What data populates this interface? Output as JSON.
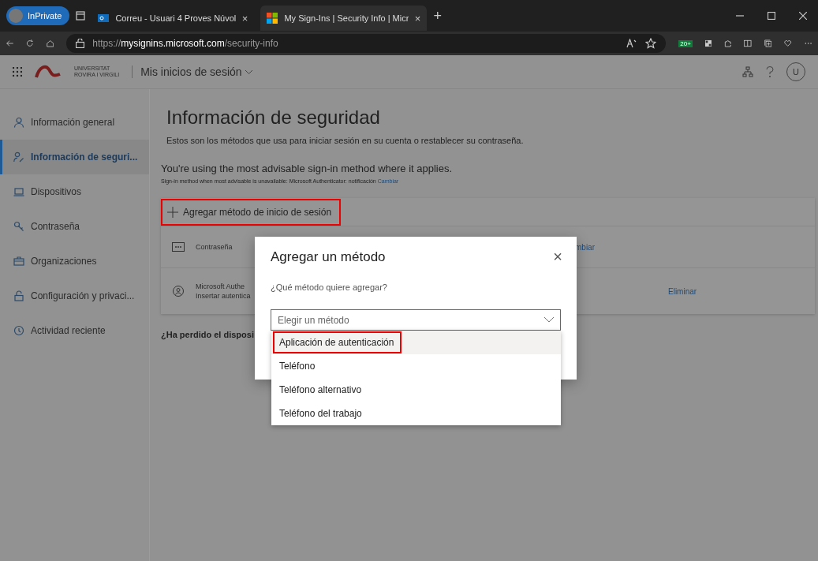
{
  "browser": {
    "profile": "InPrivate",
    "tabs": [
      {
        "title": "Correu - Usuari 4 Proves Núvol",
        "selected": false,
        "close": "×"
      },
      {
        "title": "My Sign-Ins | Security Info | Micr",
        "selected": true,
        "close": "×"
      }
    ],
    "new_tab": "+",
    "url_protocol": "https://",
    "url_domain": "mysignins.microsoft.com",
    "url_path": "/security-info",
    "extension_badge": "20+"
  },
  "header": {
    "org_line1": "UNIVERSITAT",
    "org_line2": "ROVIRA I VIRGILI",
    "app_title": "Mis inicios de sesión",
    "avatar": "U"
  },
  "sidebar": {
    "items": [
      {
        "label": "Información general",
        "selected": false
      },
      {
        "label": "Información de seguri...",
        "selected": true
      },
      {
        "label": "Dispositivos",
        "selected": false
      },
      {
        "label": "Contraseña",
        "selected": false
      },
      {
        "label": "Organizaciones",
        "selected": false
      },
      {
        "label": "Configuración y privaci...",
        "selected": false
      },
      {
        "label": "Actividad reciente",
        "selected": false
      }
    ]
  },
  "main": {
    "title": "Información de seguridad",
    "subtitle": "Estos son los métodos que usa para iniciar sesión en su cuenta o restablecer su contraseña.",
    "advisory": "You're using the most advisable sign-in method where it applies.",
    "default_note": "Sign-in method when most advisable is unavailable: Microsoft Authenticator: notificación",
    "default_link": "Cambiar",
    "add_method": {
      "label": "Agregar método de inicio de sesión",
      "highlighted": true
    },
    "methods": [
      {
        "name": "Contraseña",
        "action": "mbiar"
      },
      {
        "name": "Microsoft Authe",
        "detail": "Insertar autentica",
        "action": "Eliminar"
      }
    ],
    "lost_device": "¿Ha perdido el disposi"
  },
  "dialog": {
    "title": "Agregar un método",
    "close": "×",
    "question": "¿Qué método quiere agregar?",
    "select_placeholder": "Elegir un método",
    "options": [
      {
        "label": "Aplicación de autenticación",
        "selected": true,
        "highlighted": true
      },
      {
        "label": "Teléfono",
        "selected": false,
        "highlighted": false
      },
      {
        "label": "Teléfono alternativo",
        "selected": false,
        "highlighted": false
      },
      {
        "label": "Teléfono del trabajo",
        "selected": false,
        "highlighted": false
      }
    ]
  }
}
